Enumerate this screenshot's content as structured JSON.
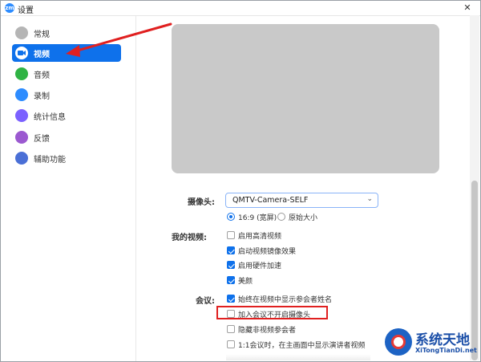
{
  "window": {
    "title": "设置",
    "app_icon_text": "zm",
    "close_glyph": "✕"
  },
  "sidebar": {
    "items": [
      {
        "label": "常规",
        "icon": "gear-icon",
        "color": "#b5b5b5"
      },
      {
        "label": "视频",
        "icon": "video-camera-icon",
        "color": "#0e71eb",
        "active": true
      },
      {
        "label": "音频",
        "icon": "headphones-icon",
        "color": "#2fb344"
      },
      {
        "label": "录制",
        "icon": "record-icon",
        "color": "#2d8cff"
      },
      {
        "label": "统计信息",
        "icon": "bar-chart-icon",
        "color": "#7b61ff"
      },
      {
        "label": "反馈",
        "icon": "smiley-icon",
        "color": "#9b59d0"
      },
      {
        "label": "辅助功能",
        "icon": "accessibility-icon",
        "color": "#4a6fd6"
      }
    ]
  },
  "video": {
    "camera_label": "摄像头:",
    "camera_value": "QMTV-Camera-SELF",
    "aspect": [
      {
        "label": "16:9 (宽屏)",
        "selected": true
      },
      {
        "label": "原始大小",
        "selected": false
      }
    ],
    "my_video_label": "我的视频:",
    "my_video_options": [
      {
        "label": "启用高清视频",
        "checked": false
      },
      {
        "label": "启动视频镜像效果",
        "checked": true
      },
      {
        "label": "启用硬件加速",
        "checked": true
      },
      {
        "label": "美颜",
        "checked": true
      }
    ],
    "meeting_label": "会议:",
    "meeting_options": [
      {
        "label": "始终在视频中显示参会者姓名",
        "checked": true
      },
      {
        "label": "加入会议不开启摄像头",
        "checked": false
      },
      {
        "label": "隐藏非视频参会者",
        "checked": false
      },
      {
        "label": "1:1会议时，在主画面中显示演讲者视频",
        "checked": false
      }
    ]
  },
  "watermark": {
    "main": "系统天地",
    "sub": "XiTongTianDi.net"
  },
  "colors": {
    "accent": "#0e71eb",
    "annotation_red": "#e02020"
  }
}
